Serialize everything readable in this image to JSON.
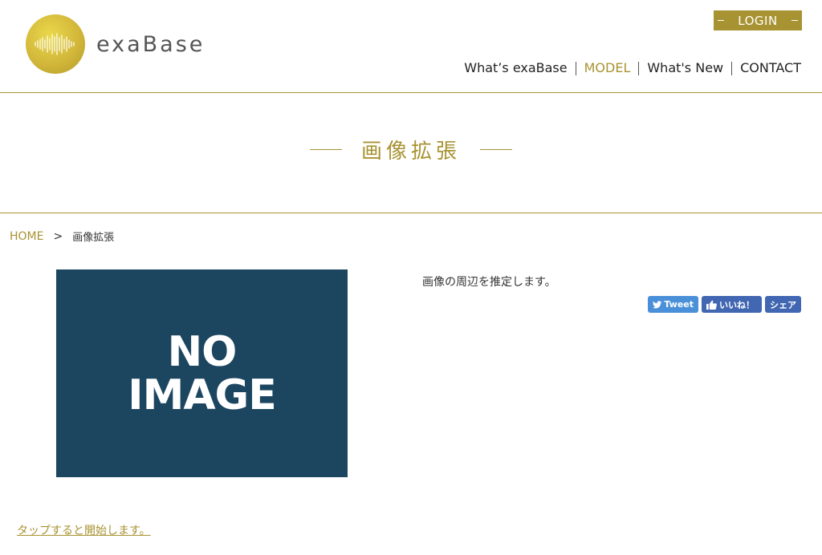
{
  "header": {
    "logo_text": "exaBase",
    "login_label": "LOGIN",
    "nav": [
      {
        "label": "What’s exaBase",
        "active": false
      },
      {
        "label": "MODEL",
        "active": true
      },
      {
        "label": "What's New",
        "active": false
      },
      {
        "label": "CONTACT",
        "active": false
      }
    ]
  },
  "page": {
    "title": "画像拡張"
  },
  "breadcrumb": {
    "home": "HOME",
    "separator": ">",
    "current": "画像拡張"
  },
  "content": {
    "image_line1": "NO",
    "image_line2": "IMAGE",
    "description": "画像の周辺を推定します。"
  },
  "social": {
    "tweet": "Tweet",
    "like": "いいね！",
    "share": "シェア"
  },
  "start_link": "タップすると開始します。",
  "colors": {
    "accent": "#a89332",
    "image_bg": "#1c4660",
    "twitter": "#4a90d9",
    "facebook": "#4267b2"
  }
}
